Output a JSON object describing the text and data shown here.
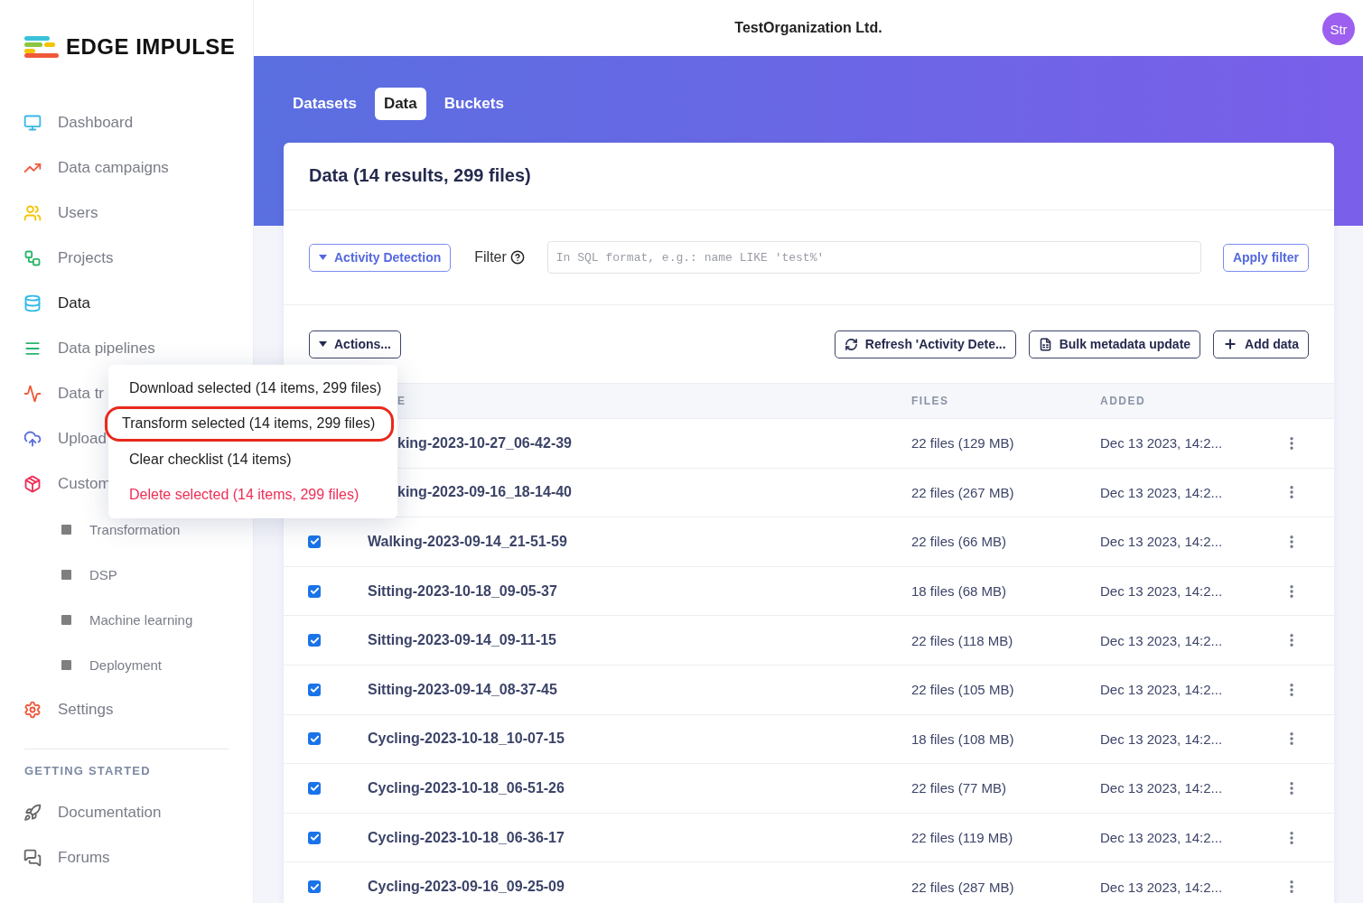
{
  "logo": {
    "text": "EDGE IMPULSE"
  },
  "sidebar": {
    "items": [
      {
        "label": "Dashboard",
        "selected": false
      },
      {
        "label": "Data campaigns",
        "selected": false
      },
      {
        "label": "Users",
        "selected": false
      },
      {
        "label": "Projects",
        "selected": false
      },
      {
        "label": "Data",
        "selected": true
      },
      {
        "label": "Data pipelines",
        "selected": false
      },
      {
        "label": "Data tr",
        "selected": false
      },
      {
        "label": "Upload",
        "selected": false
      },
      {
        "label": "Custom",
        "selected": false,
        "children": [
          {
            "label": "Transformation",
            "selected": false
          },
          {
            "label": "DSP",
            "selected": false
          },
          {
            "label": "Machine learning",
            "selected": false
          },
          {
            "label": "Deployment",
            "selected": false
          }
        ]
      },
      {
        "label": "Settings",
        "selected": false
      }
    ],
    "section": {
      "title": "GETTING STARTED",
      "items": [
        {
          "label": "Documentation"
        },
        {
          "label": "Forums"
        }
      ]
    }
  },
  "header": {
    "organization": "TestOrganization Ltd.",
    "avatar": "Str"
  },
  "tabs": [
    {
      "label": "Datasets",
      "selected": false
    },
    {
      "label": "Data",
      "selected": true
    },
    {
      "label": "Buckets",
      "selected": false
    }
  ],
  "card": {
    "title": "Data (14 results, 299 files)",
    "dataset_dropdown": "Activity Detection",
    "filter_label": "Filter",
    "filter_placeholder": "In SQL format, e.g.: name LIKE 'test%'",
    "apply_button": "Apply filter",
    "actions_button": "Actions...",
    "toolbar_buttons": [
      "Refresh 'Activity Dete...",
      "Bulk metadata update",
      "Add data"
    ]
  },
  "table": {
    "columns": [
      "E",
      "FILES",
      "ADDED"
    ],
    "rows": [
      {
        "name": "king-2023-10-27_06-42-39",
        "files": "22 files (129 MB)",
        "added": "Dec 13 2023, 14:2..."
      },
      {
        "name": "king-2023-09-16_18-14-40",
        "files": "22 files (267 MB)",
        "added": "Dec 13 2023, 14:2..."
      },
      {
        "checked": true,
        "name": "Walking-2023-09-14_21-51-59",
        "files": "22 files (66 MB)",
        "added": "Dec 13 2023, 14:2..."
      },
      {
        "checked": true,
        "name": "Sitting-2023-10-18_09-05-37",
        "files": "18 files (68 MB)",
        "added": "Dec 13 2023, 14:2..."
      },
      {
        "checked": true,
        "name": "Sitting-2023-09-14_09-11-15",
        "files": "22 files (118 MB)",
        "added": "Dec 13 2023, 14:2..."
      },
      {
        "checked": true,
        "name": "Sitting-2023-09-14_08-37-45",
        "files": "22 files (105 MB)",
        "added": "Dec 13 2023, 14:2..."
      },
      {
        "checked": true,
        "name": "Cycling-2023-10-18_10-07-15",
        "files": "18 files (108 MB)",
        "added": "Dec 13 2023, 14:2..."
      },
      {
        "checked": true,
        "name": "Cycling-2023-10-18_06-51-26",
        "files": "22 files (77 MB)",
        "added": "Dec 13 2023, 14:2..."
      },
      {
        "checked": true,
        "name": "Cycling-2023-10-18_06-36-17",
        "files": "22 files (119 MB)",
        "added": "Dec 13 2023, 14:2..."
      },
      {
        "checked": true,
        "name": "Cycling-2023-09-16_09-25-09",
        "files": "22 files (287 MB)",
        "added": "Dec 13 2023, 14:2..."
      }
    ]
  },
  "actions_menu": {
    "items": [
      {
        "label": "Download selected (14 items, 299 files)",
        "kind": "normal",
        "highlighted": false
      },
      {
        "label": "Transform selected (14 items, 299 files)",
        "kind": "normal",
        "highlighted": true
      },
      {
        "label": "Clear checklist (14 items)",
        "kind": "normal",
        "highlighted": false
      },
      {
        "label": "Delete selected (14 items, 299 files)",
        "kind": "danger",
        "highlighted": false
      }
    ]
  }
}
